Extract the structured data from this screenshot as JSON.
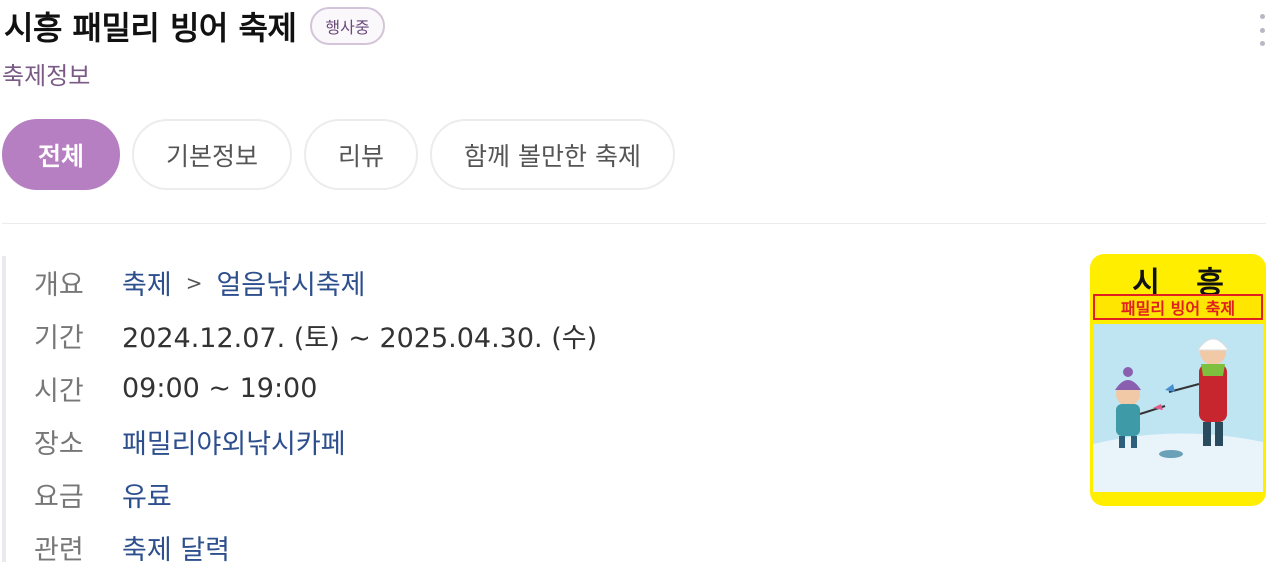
{
  "header": {
    "title": "시흥 패밀리 빙어 축제",
    "status": "행사중",
    "subtitle": "축제정보"
  },
  "tabs": [
    {
      "label": "전체",
      "active": true
    },
    {
      "label": "기본정보",
      "active": false
    },
    {
      "label": "리뷰",
      "active": false
    },
    {
      "label": "함께 볼만한 축제",
      "active": false
    }
  ],
  "info": {
    "overview": {
      "label": "개요",
      "category": "축제",
      "separator": ">",
      "subcategory": "얼음낚시축제"
    },
    "period": {
      "label": "기간",
      "value": "2024.12.07. (토) ~  2025.04.30. (수)"
    },
    "time": {
      "label": "시간",
      "value": "09:00 ~ 19:00"
    },
    "place": {
      "label": "장소",
      "value": "패밀리야외낚시카페"
    },
    "fee": {
      "label": "요금",
      "value": "유료"
    },
    "related": {
      "label": "관련",
      "value": "축제 달력"
    }
  },
  "poster": {
    "title_left": "시",
    "title_right": "흥",
    "subtitle": "패밀리 빙어 축제"
  },
  "colors": {
    "accent": "#b57fc1",
    "link": "#2d4f8e",
    "poster_bg": "#ffee00",
    "poster_red": "#e02020"
  }
}
